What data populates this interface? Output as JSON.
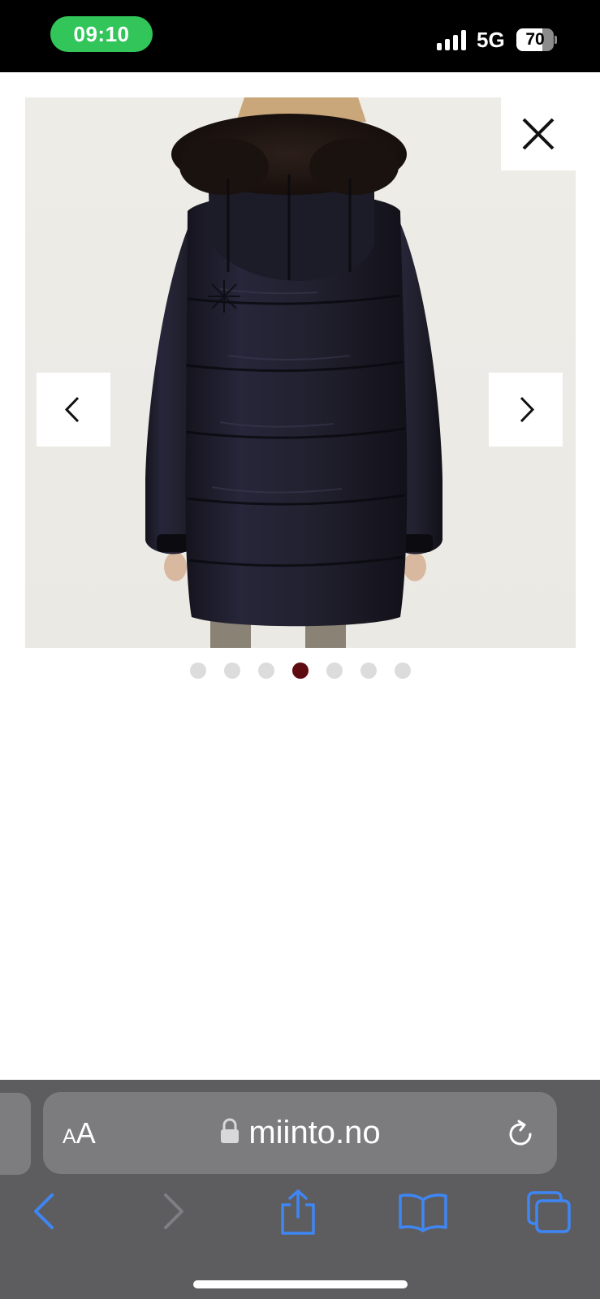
{
  "status_bar": {
    "time": "09:10",
    "network": "5G",
    "battery_level": "70",
    "battery_fraction": 0.7,
    "time_pill_color": "#32c55a"
  },
  "gallery": {
    "total_images": 7,
    "current_image": 4,
    "active_dot_color": "#5e0b12",
    "inactive_dot_color": "#dcdcdc",
    "image_icon": "product-photo-jacket-back",
    "close_icon": "close-icon",
    "prev_icon": "chevron-left-icon",
    "next_icon": "chevron-right-icon"
  },
  "browser": {
    "text_size_small": "A",
    "text_size_large": "A",
    "url": "miinto.no",
    "lock_icon": "lock-icon",
    "reload_icon": "reload-icon",
    "accent_color": "#3f86f5",
    "toolbar": [
      {
        "name": "back",
        "icon": "chevron-left-icon",
        "enabled": true
      },
      {
        "name": "forward",
        "icon": "chevron-right-icon",
        "enabled": false
      },
      {
        "name": "share",
        "icon": "share-icon",
        "enabled": true
      },
      {
        "name": "bookmarks",
        "icon": "book-icon",
        "enabled": true
      },
      {
        "name": "tabs",
        "icon": "tabs-icon",
        "enabled": true
      }
    ]
  }
}
